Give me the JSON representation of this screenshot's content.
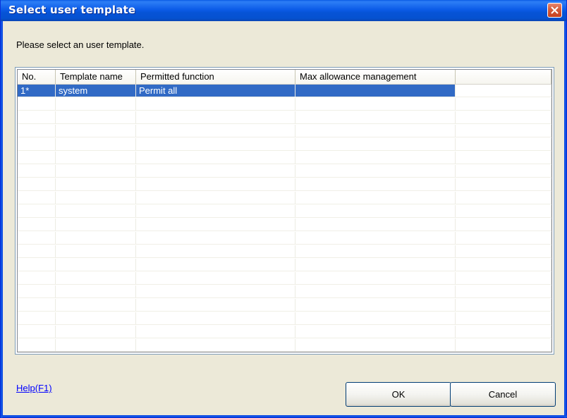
{
  "window": {
    "title": "Select user template"
  },
  "prompt": "Please select an user template.",
  "table": {
    "columns": [
      "No.",
      "Template name",
      "Permitted function",
      "Max allowance management",
      ""
    ],
    "rows": [
      {
        "no": "1*",
        "template_name": "system",
        "permitted_function": "Permit all",
        "max_allowance": "",
        "extra": "",
        "selected": true
      }
    ],
    "empty_row_count": 19
  },
  "footer": {
    "help_label": "Help(F1)",
    "ok_label": "OK",
    "cancel_label": "Cancel"
  },
  "colors": {
    "selection": "#316ac5",
    "titlebar": "#0a5be4",
    "link": "#0000ff"
  },
  "icons": {
    "close": "close-icon"
  }
}
